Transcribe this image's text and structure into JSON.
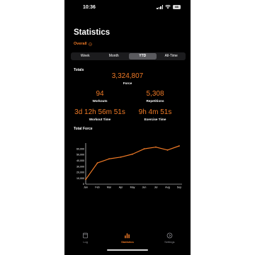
{
  "status_bar": {
    "time": "10:36",
    "battery": "88"
  },
  "header": {
    "title": "Statistics",
    "scope_label": "Overall"
  },
  "period_tabs": [
    {
      "label": "Week",
      "active": false
    },
    {
      "label": "Month",
      "active": false
    },
    {
      "label": "YTD",
      "active": true
    },
    {
      "label": "All-Time",
      "active": false
    }
  ],
  "totals": {
    "section_label": "Totals",
    "force": {
      "value": "3,324,807",
      "label": "Force"
    },
    "workouts": {
      "value": "94",
      "label": "Workouts"
    },
    "repetitions": {
      "value": "5,308",
      "label": "Repetitions"
    },
    "workout_time": {
      "value": "3d 12h 56m 51s",
      "label": "Workout Time"
    },
    "exercise_time": {
      "value": "9h 4m 51s",
      "label": "Exercise Time"
    }
  },
  "chart_section_label": "Total Force",
  "chart_data": {
    "type": "line",
    "title": "Total Force",
    "xlabel": "",
    "ylabel": "",
    "categories": [
      "Jan",
      "Feb",
      "Mar",
      "Apr",
      "May",
      "Jun",
      "Jul",
      "Aug",
      "Sep"
    ],
    "y_ticks": [
      "0",
      "10,000",
      "20,000",
      "30,000",
      "40,000",
      "50,000",
      "60,000"
    ],
    "ylim": [
      0,
      65000
    ],
    "grid": false,
    "series": [
      {
        "values": [
          8000,
          36000,
          43000,
          46000,
          51000,
          60000,
          63000,
          58000,
          65000
        ]
      }
    ],
    "color": "#f07a26"
  },
  "tab_bar": {
    "tabs": [
      {
        "label": "Log",
        "icon": "log-icon",
        "active": false
      },
      {
        "label": "Statistics",
        "icon": "bar-chart-icon",
        "active": true
      },
      {
        "label": "Settings",
        "icon": "settings-icon",
        "active": false
      }
    ]
  },
  "colors": {
    "accent": "#f07a26",
    "background": "#000000",
    "segment_bg": "#1c1c1e",
    "segment_active": "#5a5a5e"
  }
}
